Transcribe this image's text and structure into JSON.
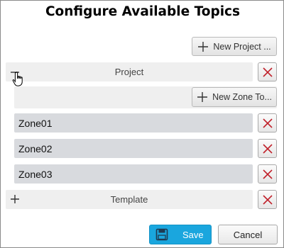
{
  "dialog": {
    "title": "Configure Available Topics"
  },
  "buttons": {
    "new_project": "New Project ...",
    "new_zone": "New Zone To...",
    "save": "Save",
    "cancel": "Cancel"
  },
  "tree": {
    "project": {
      "label": "Project",
      "expanded": true
    },
    "zones": [
      {
        "label": "Zone01"
      },
      {
        "label": "Zone02"
      },
      {
        "label": "Zone03"
      }
    ],
    "template": {
      "label": "Template",
      "expanded": false
    }
  },
  "colors": {
    "delete_x": "#c0202a",
    "save_bg": "#1aa6de",
    "row_bg": "#efefef",
    "zone_bg": "#d8dade"
  },
  "icons": {
    "add": "plus-icon",
    "delete": "close-x-icon",
    "collapse": "minus-icon",
    "expand": "plus-icon",
    "save": "floppy-disk-icon",
    "cursor": "hand-pointer-icon"
  }
}
